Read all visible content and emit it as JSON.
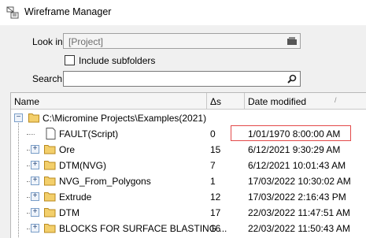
{
  "window": {
    "title": "Wireframe Manager",
    "app_icon": "wireframe-manager-icon"
  },
  "lookin": {
    "label": "Look in",
    "value": "[Project]"
  },
  "include_subfolders": {
    "label": "Include subfolders",
    "checked": false
  },
  "search": {
    "label": "Search",
    "value": ""
  },
  "columns": {
    "name": "Name",
    "delta": "Δs",
    "date": "Date modified"
  },
  "root": {
    "label": "C:\\Micromine Projects\\Examples(2021)",
    "expanded": true
  },
  "rows": [
    {
      "name": "FAULT(Script)",
      "delta": "0",
      "date": "1/01/1970 8:00:00 AM",
      "icon": "document-icon",
      "expandable": false
    },
    {
      "name": "Ore",
      "delta": "15",
      "date": "6/12/2021 9:30:29 AM",
      "icon": "folder-icon",
      "expandable": true
    },
    {
      "name": "DTM(NVG)",
      "delta": "7",
      "date": "6/12/2021 10:01:43 AM",
      "icon": "folder-icon",
      "expandable": true
    },
    {
      "name": "NVG_From_Polygons",
      "delta": "1",
      "date": "17/03/2022 10:30:02 AM",
      "icon": "folder-icon",
      "expandable": true
    },
    {
      "name": "Extrude",
      "delta": "12",
      "date": "17/03/2022 2:16:43 PM",
      "icon": "folder-icon",
      "expandable": true
    },
    {
      "name": "DTM",
      "delta": "17",
      "date": "22/03/2022 11:47:51 AM",
      "icon": "folder-icon",
      "expandable": true
    },
    {
      "name": "BLOCKS FOR SURFACE BLASTING ...",
      "delta": "16",
      "date": "22/03/2022 11:50:43 AM",
      "icon": "folder-icon",
      "expandable": true
    }
  ],
  "colors": {
    "highlight_border": "#e34a4a",
    "folder": "#e8b84a"
  }
}
